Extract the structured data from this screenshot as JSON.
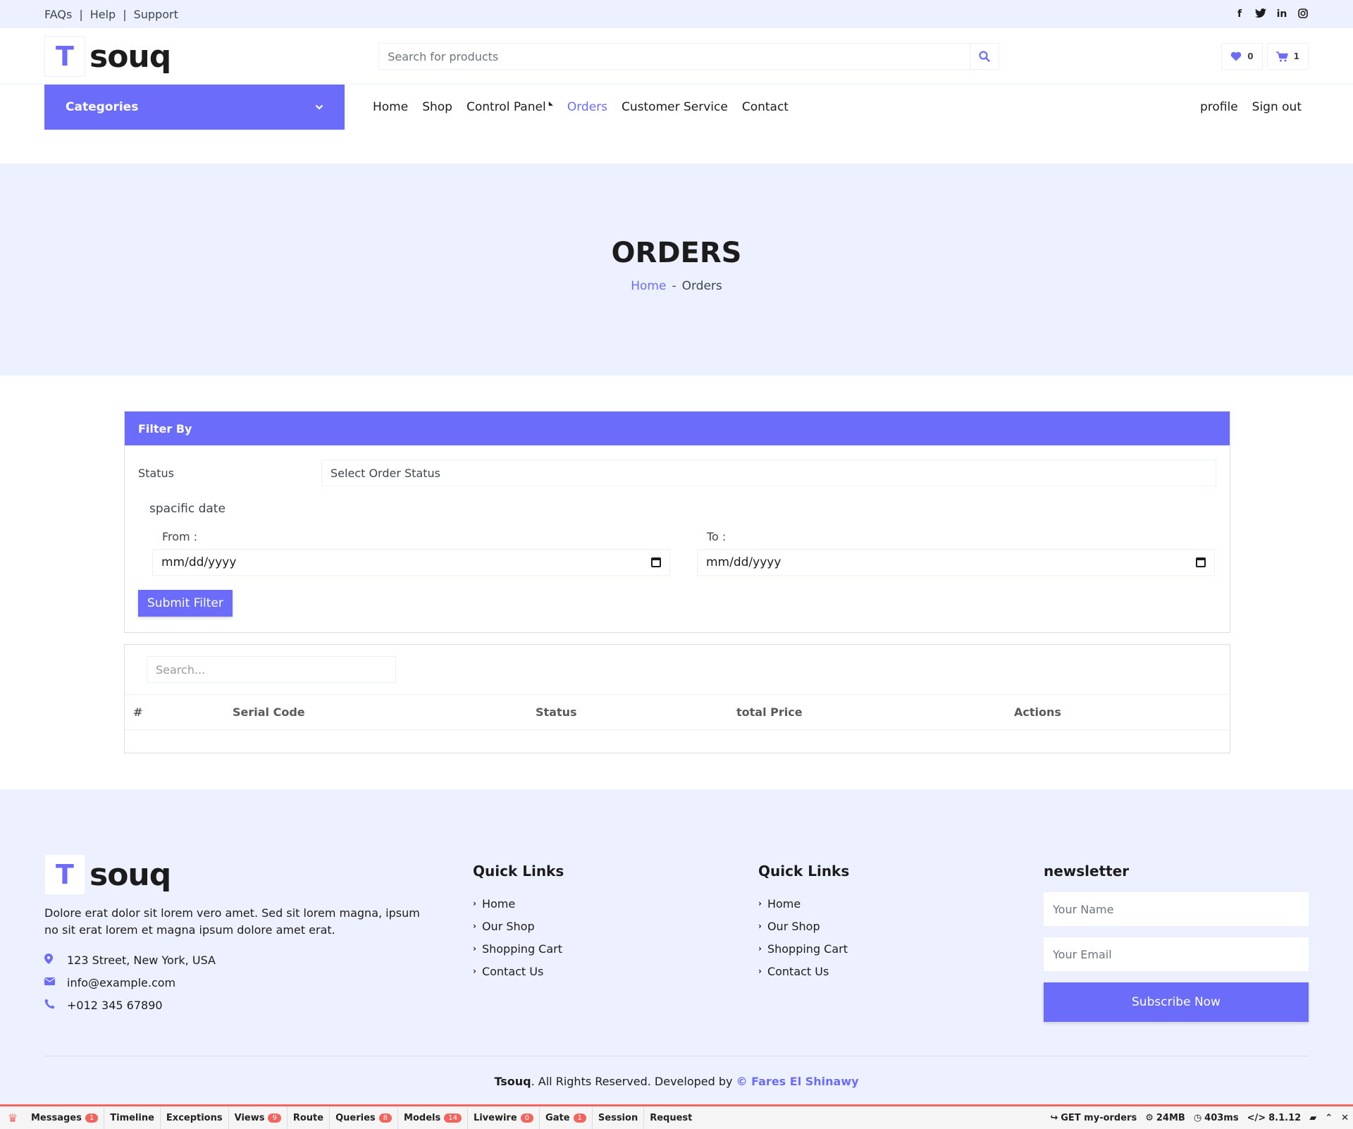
{
  "topbar": {
    "links": [
      "FAQs",
      "Help",
      "Support"
    ],
    "social_icons": [
      "facebook-icon",
      "twitter-icon",
      "linkedin-icon",
      "instagram-icon"
    ]
  },
  "header": {
    "logo_mark": "T",
    "logo_word": "souq",
    "search_placeholder": "Search for products",
    "wishlist_count": "0",
    "cart_count": "1"
  },
  "nav": {
    "categories_label": "Categories",
    "items": [
      "Home",
      "Shop",
      "Control Panel",
      "Orders",
      "Customer Service",
      "Contact"
    ],
    "active": "Orders",
    "right": [
      "profile",
      "Sign out"
    ]
  },
  "page": {
    "title": "ORDERS",
    "breadcrumb_home": "Home",
    "breadcrumb_sep": "-",
    "breadcrumb_current": "Orders"
  },
  "filter": {
    "heading": "Filter By",
    "status_label": "Status",
    "status_value": "Select Order Status",
    "specific_date_label": "spacific date",
    "from_label": "From :",
    "to_label": "To :",
    "from_value": "mm/dd/yyyy",
    "to_value": "mm/dd/yyyy",
    "submit_label": "Submit Filter"
  },
  "table": {
    "search_placeholder": "Search...",
    "columns": [
      "#",
      "Serial Code",
      "Status",
      "total Price",
      "Actions"
    ],
    "rows": []
  },
  "footer": {
    "logo_mark": "T",
    "logo_word": "souq",
    "description": "Dolore erat dolor sit lorem vero amet. Sed sit lorem magna, ipsum no sit erat lorem et magna ipsum dolore amet erat.",
    "address": "123 Street, New York, USA",
    "email": "info@example.com",
    "phone": "+012 345 67890",
    "col2_title": "Quick Links",
    "col2_links": [
      "Home",
      "Our Shop",
      "Shopping Cart",
      "Contact Us"
    ],
    "col3_title": "Quick Links",
    "col3_links": [
      "Home",
      "Our Shop",
      "Shopping Cart",
      "Contact Us"
    ],
    "newsletter_title": "newsletter",
    "name_placeholder": "Your Name",
    "email_placeholder": "Your Email",
    "subscribe_label": "Subscribe Now",
    "copyright_brand": "Tsouq",
    "copyright_text": ". All Rights Reserved. Developed by ",
    "developer": "© Fares El Shinawy"
  },
  "debugbar": {
    "tabs": [
      {
        "label": "Messages",
        "badge": "1"
      },
      {
        "label": "Timeline",
        "badge": ""
      },
      {
        "label": "Exceptions",
        "badge": ""
      },
      {
        "label": "Views",
        "badge": "9"
      },
      {
        "label": "Route",
        "badge": ""
      },
      {
        "label": "Queries",
        "badge": "8"
      },
      {
        "label": "Models",
        "badge": "14"
      },
      {
        "label": "Livewire",
        "badge": "0"
      },
      {
        "label": "Gate",
        "badge": "1"
      },
      {
        "label": "Session",
        "badge": ""
      },
      {
        "label": "Request",
        "badge": ""
      }
    ],
    "route": "GET my-orders",
    "memory": "24MB",
    "time": "403ms",
    "php": "8.1.12"
  },
  "colors": {
    "accent": "#6b6dfa",
    "light_bg": "#edf1ff",
    "debug_red": "#f4645f"
  }
}
